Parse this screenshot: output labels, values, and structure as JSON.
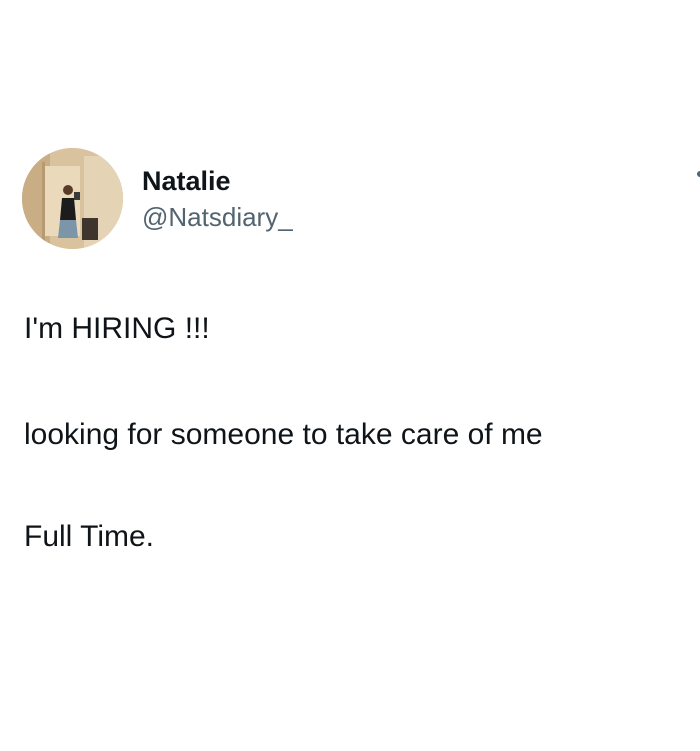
{
  "tweet": {
    "author": {
      "display_name": "Natalie",
      "handle": "@Natsdiary_",
      "avatar_icon": "profile-photo"
    },
    "more_icon": "more-options-icon",
    "text_lines": [
      "I'm HIRING !!!",
      "looking for someone to take care of me",
      "Full Time."
    ]
  },
  "colors": {
    "background": "#ffffff",
    "text_primary": "#0f1419",
    "text_secondary": "#536471"
  }
}
